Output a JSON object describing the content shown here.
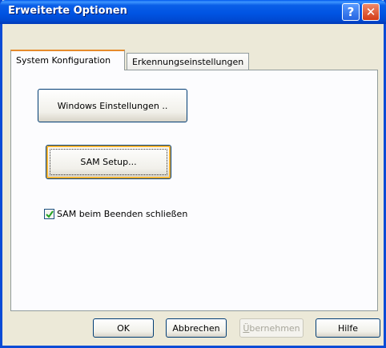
{
  "window": {
    "title": "Erweiterte Optionen",
    "help_label": "?",
    "close_label": "✕",
    "help_icon": "question-icon",
    "close_icon": "close-icon"
  },
  "tabs": [
    {
      "label": "System Konfiguration",
      "selected": true
    },
    {
      "label": "Erkennungseinstellungen",
      "selected": false
    }
  ],
  "panel": {
    "windows_settings_button": "Windows Einstellungen ..",
    "sam_setup_button": "SAM Setup...",
    "close_on_exit": {
      "label": "SAM beim Beenden schließen",
      "checked": true
    }
  },
  "footer": {
    "ok": "OK",
    "cancel": "Abbrechen",
    "apply_underlined": "Ü",
    "apply_rest": "bernehmen",
    "apply_enabled": false,
    "help": "Hilfe"
  },
  "colors": {
    "title_bar": "#0054e3",
    "dialog_bg": "#ece9d8",
    "active_tab_accent": "#e68b2c",
    "checkmark": "#21a121"
  }
}
